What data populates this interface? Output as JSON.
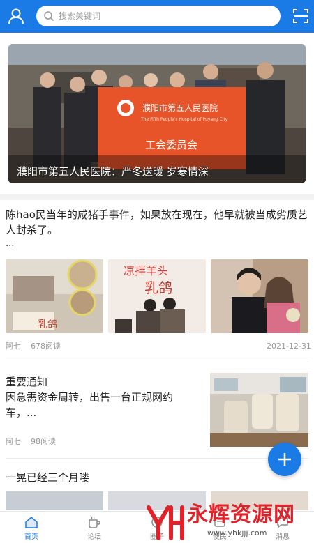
{
  "header": {
    "search_placeholder": "搜索关键词",
    "accent_color": "#1a7ae6"
  },
  "banner": {
    "caption": "濮阳市第五人民医院：严冬送暖 岁寒情深",
    "flag_text_cn": "濮阳市第五人民医院",
    "flag_text_en": "The Fifth People's Hospital of Puyang City",
    "flag_text_union": "工会委员会"
  },
  "article1": {
    "title": "陈hao民当年的咸猪手事件，如果放在现在，他早就被当成劣质艺人封杀了。",
    "more": "...",
    "thumb2_sign": "凉拌羊头",
    "thumb2_sign2": "乳鸽",
    "thumb1_sign": "乳鸽",
    "author": "阿七",
    "reads": "678阅读",
    "date": "2021-12-31"
  },
  "article2": {
    "title": "重要通知\n因急需资金周转，出售一台正规网约车，...",
    "author": "阿七",
    "reads": "98阅读"
  },
  "article3": {
    "title": "一晃已经三个月喽"
  },
  "tabs": [
    {
      "label": "首页",
      "icon": "home-icon",
      "active": true
    },
    {
      "label": "论坛",
      "icon": "coffee-cup-icon",
      "active": false
    },
    {
      "label": "圈子",
      "icon": "circle-icon",
      "active": false
    },
    {
      "label": "便民",
      "icon": "service-icon",
      "active": false
    },
    {
      "label": "消息",
      "icon": "message-icon",
      "active": false
    }
  ],
  "watermark": {
    "text": "永辉资源网",
    "url": "www.yhkjjj.com"
  }
}
